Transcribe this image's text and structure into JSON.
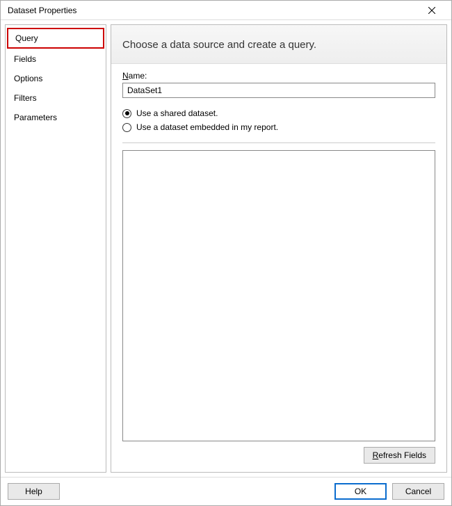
{
  "title": "Dataset Properties",
  "sidebar": {
    "items": [
      {
        "label": "Query",
        "selected": true
      },
      {
        "label": "Fields",
        "selected": false
      },
      {
        "label": "Options",
        "selected": false
      },
      {
        "label": "Filters",
        "selected": false
      },
      {
        "label": "Parameters",
        "selected": false
      }
    ]
  },
  "main": {
    "header": "Choose a data source and create a query.",
    "name_label_underline": "N",
    "name_label_rest": "ame:",
    "name_value": "DataSet1",
    "radios": {
      "shared": "Use a shared dataset.",
      "embedded": "Use a dataset embedded in my report.",
      "selected": "shared"
    },
    "refresh_underline": "R",
    "refresh_rest": "efresh Fields"
  },
  "footer": {
    "help": "Help",
    "ok": "OK",
    "cancel": "Cancel"
  }
}
